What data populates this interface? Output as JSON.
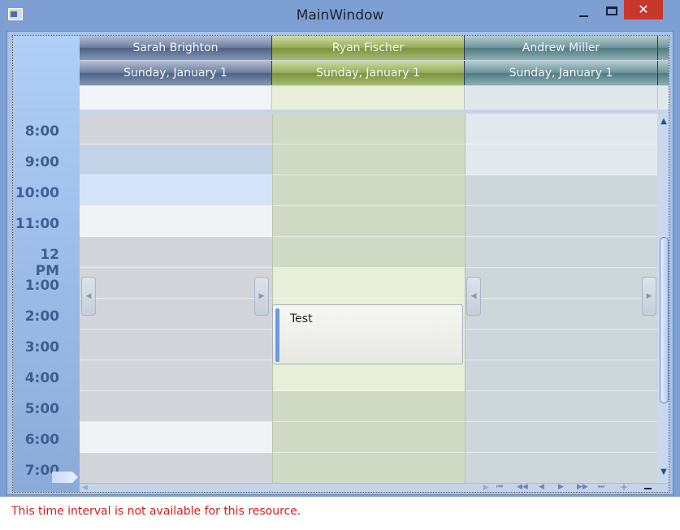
{
  "window": {
    "title": "MainWindow",
    "close_glyph": "✕"
  },
  "resources": [
    {
      "name": "Sarah Brighton",
      "date": "Sunday, January 1"
    },
    {
      "name": "Ryan Fischer",
      "date": "Sunday, January 1"
    },
    {
      "name": "Andrew Miller",
      "date": "Sunday, January 1"
    }
  ],
  "time_slots": [
    "8:00",
    "9:00",
    "10:00",
    "11:00",
    "12 PM",
    "1:00",
    "2:00",
    "3:00",
    "4:00",
    "5:00",
    "6:00",
    "7:00"
  ],
  "appointment": {
    "subject": "Test"
  },
  "status": {
    "message": "This time interval is not available for this resource."
  },
  "icons": {
    "scroll_up": "▲",
    "scroll_down": "▼",
    "scroll_left": "◀",
    "scroll_right": "▶",
    "nav_left": "◀",
    "nav_right": "▶",
    "first": "⏮",
    "prev_page": "◀◀",
    "prev": "◀",
    "next": "▶",
    "next_page": "▶▶",
    "last": "⏭",
    "zoom_in": "+"
  },
  "colors": {
    "accent": "#6b9ae0",
    "status_error": "#d51f1a",
    "close": "#c8372d"
  }
}
